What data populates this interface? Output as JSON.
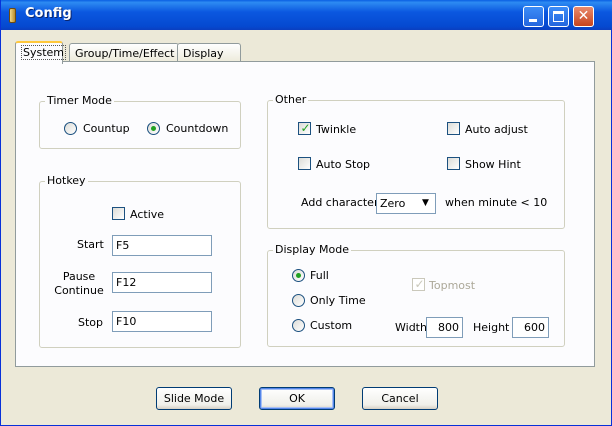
{
  "window": {
    "title": "Config",
    "icon": "bell-icon",
    "controls": {
      "minimize": "minimize-icon",
      "maximize": "maximize-icon",
      "close": "close-icon"
    }
  },
  "tabs": [
    {
      "label": "System",
      "active": true
    },
    {
      "label": "Group/Time/Effect",
      "active": false
    },
    {
      "label": "Display",
      "active": false
    }
  ],
  "timer_mode": {
    "title": "Timer Mode",
    "options": [
      {
        "label": "Countup",
        "selected": false
      },
      {
        "label": "Countdown",
        "selected": true
      }
    ]
  },
  "hotkey": {
    "title": "Hotkey",
    "active": {
      "label": "Active",
      "checked": false
    },
    "start": {
      "label": "Start",
      "value": "F5"
    },
    "pause_continue": {
      "label_line1": "Pause",
      "label_line2": "Continue",
      "value": "F12"
    },
    "stop": {
      "label": "Stop",
      "value": "F10"
    }
  },
  "other": {
    "title": "Other",
    "twinkle": {
      "label": "Twinkle",
      "checked": true
    },
    "auto_adjust": {
      "label": "Auto adjust",
      "checked": false
    },
    "auto_stop": {
      "label": "Auto Stop",
      "checked": false
    },
    "show_hint": {
      "label": "Show Hint",
      "checked": false
    },
    "add_character": {
      "label": "Add character",
      "value": "Zero",
      "suffix": "when minute < 10"
    }
  },
  "display_mode": {
    "title": "Display Mode",
    "options": [
      {
        "label": "Full",
        "selected": true
      },
      {
        "label": "Only Time",
        "selected": false
      },
      {
        "label": "Custom",
        "selected": false
      }
    ],
    "topmost": {
      "label": "Topmost",
      "checked": true,
      "disabled": true
    },
    "width": {
      "label": "Width",
      "value": "800"
    },
    "height": {
      "label": "Height",
      "value": "600"
    }
  },
  "buttons": {
    "slide_mode": "Slide Mode",
    "ok": "OK",
    "cancel": "Cancel"
  },
  "colors": {
    "titlebar": "#0a5fe3",
    "dialog_bg": "#ece9d8",
    "check_green": "#21a121",
    "active_tab_accent": "#ffc83c"
  }
}
